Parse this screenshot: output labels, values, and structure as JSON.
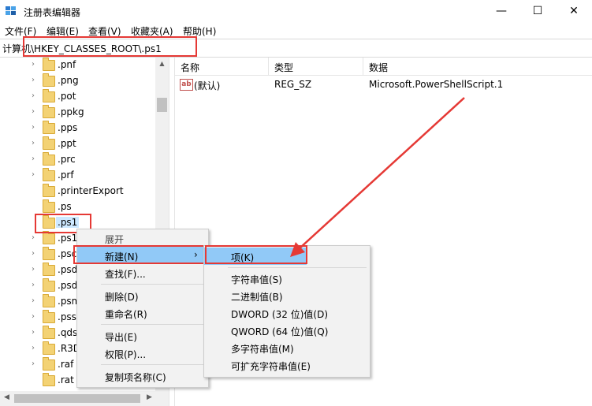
{
  "window": {
    "title": "注册表编辑器",
    "minimize_glyph": "—",
    "maximize_glyph": "☐",
    "close_glyph": "✕"
  },
  "menu": [
    "文件(F)",
    "编辑(E)",
    "查看(V)",
    "收藏夹(A)",
    "帮助(H)"
  ],
  "address": "计算机\\HKEY_CLASSES_ROOT\\.ps1",
  "tree": {
    "items": [
      ".pnf",
      ".png",
      ".pot",
      ".ppkg",
      ".pps",
      ".ppt",
      ".prc",
      ".prf",
      ".printerExport",
      ".ps",
      ".ps1",
      ".ps1",
      ".psc",
      ".psd",
      ".psd",
      ".psm",
      ".pss",
      ".qds",
      ".R3D",
      ".raf",
      ".rat"
    ]
  },
  "list": {
    "headers": [
      "名称",
      "类型",
      "数据"
    ],
    "row": {
      "icon": "ab",
      "name": "(默认)",
      "type": "REG_SZ",
      "data": "Microsoft.PowerShellScript.1"
    }
  },
  "context_menu": {
    "items": [
      "展开",
      "新建(N)",
      "查找(F)...",
      "删除(D)",
      "重命名(R)",
      "导出(E)",
      "权限(P)...",
      "复制项名称(C)"
    ],
    "submenu_arrow": "›"
  },
  "submenu": {
    "items": [
      "项(K)",
      "字符串值(S)",
      "二进制值(B)",
      "DWORD (32 位)值(D)",
      "QWORD (64 位)值(Q)",
      "多字符串值(M)",
      "可扩充字符串值(E)"
    ]
  },
  "colors": {
    "annotation": "#e53935",
    "highlight": "#91c9f7",
    "selection": "#cce8ff"
  }
}
